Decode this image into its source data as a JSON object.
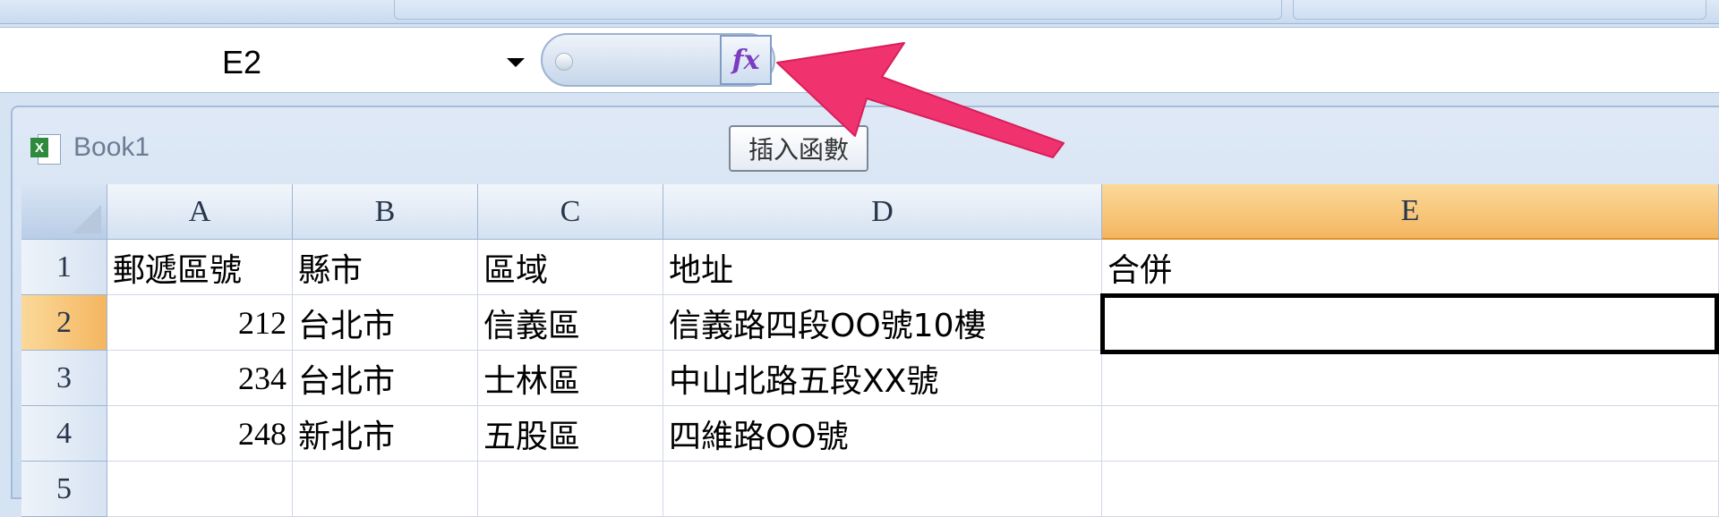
{
  "formula_bar": {
    "name_box": "E2",
    "fx_label": "fx",
    "formula_value": ""
  },
  "workbook": {
    "title": "Book1"
  },
  "tooltip": {
    "text": "插入函數"
  },
  "sheet": {
    "columns": [
      "A",
      "B",
      "C",
      "D",
      "E"
    ],
    "rows": [
      "1",
      "2",
      "3",
      "4",
      "5"
    ],
    "cells": [
      [
        "郵遞區號",
        "縣市",
        "區域",
        "地址",
        "合併"
      ],
      [
        "212",
        "台北市",
        "信義區",
        "信義路四段OO號10樓",
        ""
      ],
      [
        "234",
        "台北市",
        "士林區",
        "中山北路五段XX號",
        ""
      ],
      [
        "248",
        "新北市",
        "五股區",
        "四維路OO號",
        ""
      ],
      [
        "",
        "",
        "",
        "",
        ""
      ]
    ],
    "active_cell": "E2"
  },
  "colors": {
    "selected_header": "#f4b660",
    "annotation_arrow": "#f0336e",
    "fx_glyph": "#7a3dbf"
  }
}
